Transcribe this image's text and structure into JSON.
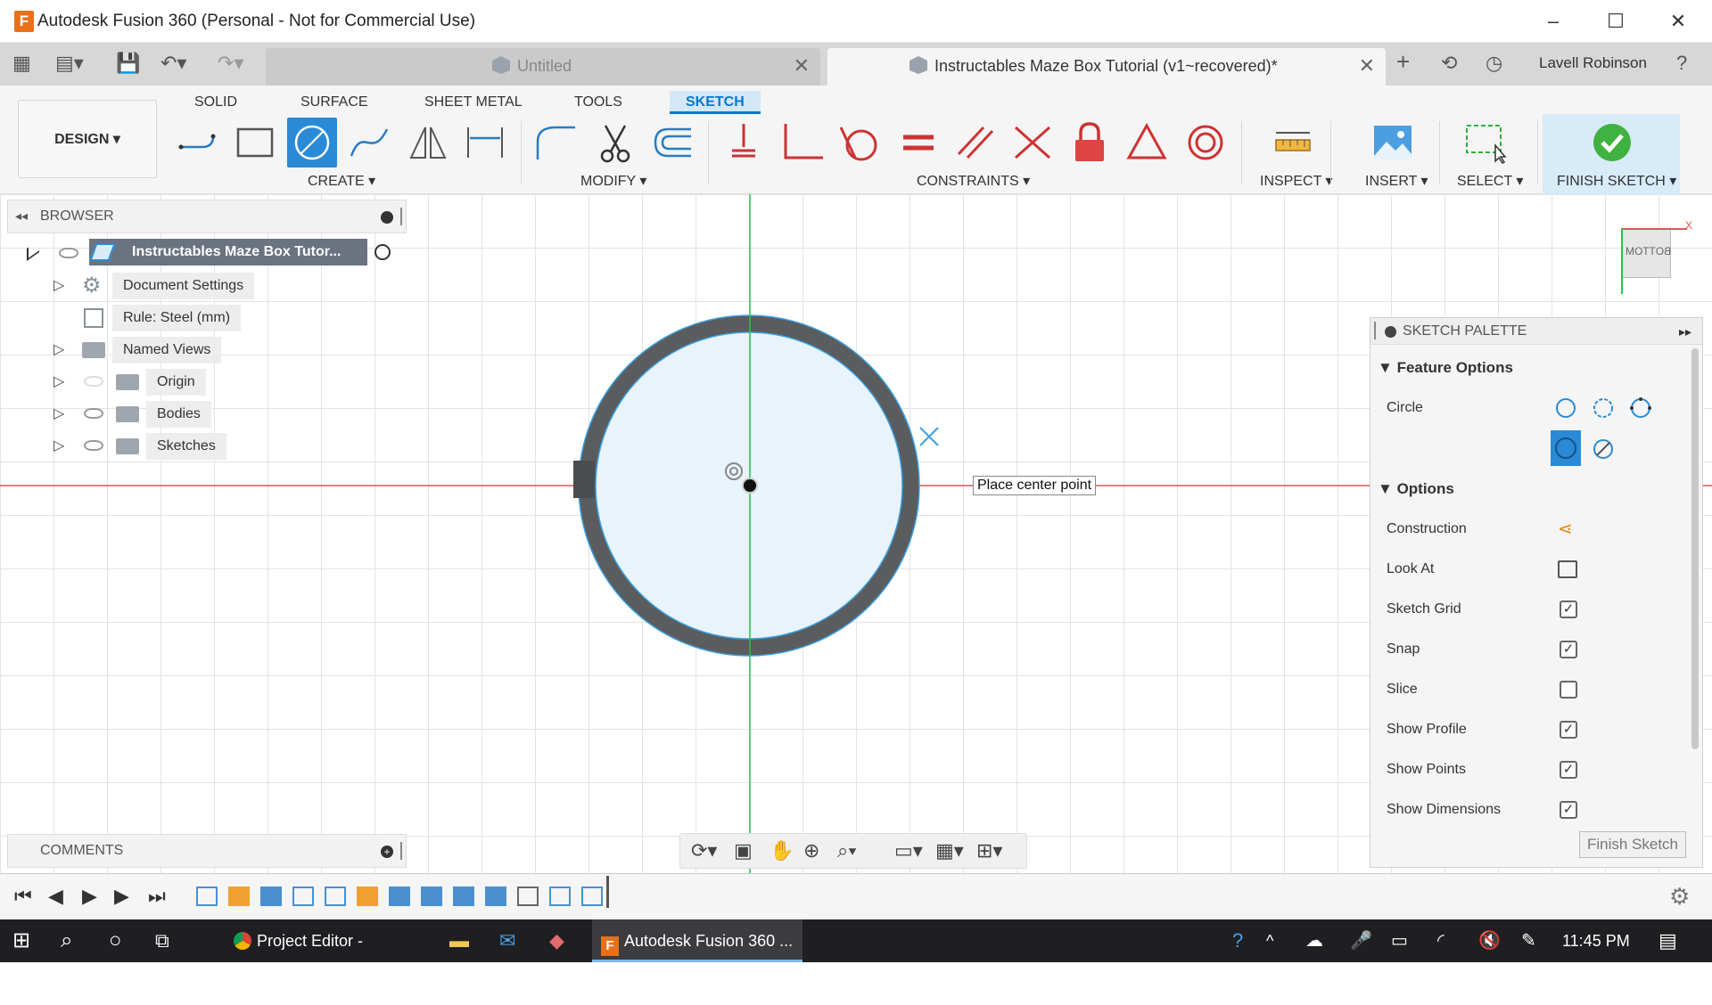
{
  "window": {
    "logo_letter": "F",
    "title": "Autodesk Fusion 360 (Personal - Not for Commercial Use)",
    "controls": {
      "minimize": "–",
      "maximize": "☐",
      "close": "✕"
    }
  },
  "tabs": [
    {
      "label": "Untitled",
      "active": false
    },
    {
      "label": "Instructables Maze Box Tutorial (v1~recovered)*",
      "active": true
    }
  ],
  "user": {
    "name": "Lavell Robinson"
  },
  "workspace": {
    "label": "DESIGN ▾"
  },
  "toolbar_tabs": [
    "SOLID",
    "SURFACE",
    "SHEET METAL",
    "TOOLS",
    "SKETCH"
  ],
  "toolbar_groups": {
    "create": "CREATE ▾",
    "modify": "MODIFY ▾",
    "constraints": "CONSTRAINTS ▾",
    "inspect": "INSPECT ▾",
    "insert": "INSERT ▾",
    "select": "SELECT ▾",
    "finish": "FINISH SKETCH ▾"
  },
  "browser": {
    "title": "BROWSER",
    "root": "Instructables Maze Box Tutor...",
    "items": [
      {
        "label": "Document Settings",
        "icon": "gear-icon"
      },
      {
        "label": "Rule: Steel (mm)",
        "icon": "rule-icon"
      },
      {
        "label": "Named Views",
        "icon": "folder-icon"
      },
      {
        "label": "Origin",
        "icon": "folder-icon"
      },
      {
        "label": "Bodies",
        "icon": "folder-icon"
      },
      {
        "label": "Sketches",
        "icon": "folder-icon"
      }
    ]
  },
  "comments": {
    "title": "COMMENTS"
  },
  "viewcube": {
    "face": "BOTTOM",
    "axis": "X"
  },
  "tooltip": "Place center point",
  "palette": {
    "title": "SKETCH PALETTE",
    "feature_options": "Feature Options",
    "circle_label": "Circle",
    "options_title": "Options",
    "options": [
      {
        "label": "Construction",
        "control": "construction-icon"
      },
      {
        "label": "Look At",
        "control": "look-at-icon"
      },
      {
        "label": "Sketch Grid",
        "checked": true
      },
      {
        "label": "Snap",
        "checked": true
      },
      {
        "label": "Slice",
        "checked": false
      },
      {
        "label": "Show Profile",
        "checked": true
      },
      {
        "label": "Show Points",
        "checked": true
      },
      {
        "label": "Show Dimensions",
        "checked": true
      }
    ],
    "finish_button": "Finish Sketch"
  },
  "taskbar": {
    "items": [
      {
        "label": "Project Editor - Instruc...",
        "icon": "chrome-icon"
      },
      {
        "label": "Autodesk Fusion 360 ...",
        "icon": "fusion-icon"
      }
    ],
    "time": "11:45 PM"
  },
  "colors": {
    "accent": "#0a78c8",
    "sketch_ring": "#5a5c5e",
    "profile_fill": "#e8f3fc",
    "x_axis": "#e05555",
    "y_axis": "#2fbf4f"
  }
}
